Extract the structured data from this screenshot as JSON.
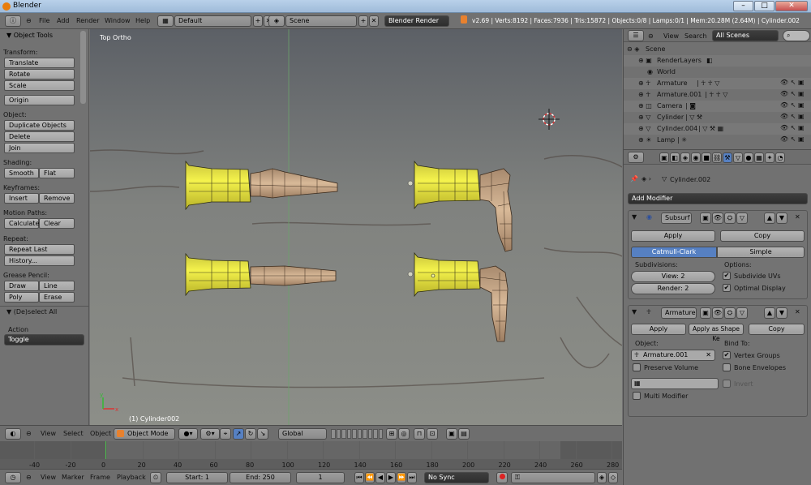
{
  "window": {
    "title": "Blender"
  },
  "info": {
    "menus": [
      "File",
      "Add",
      "Render",
      "Window",
      "Help"
    ],
    "screen_layout": "Default",
    "scene": "Scene",
    "engine": "Blender Render",
    "stats": "v2.69 | Verts:8192 | Faces:7936 | Tris:15872 | Objects:0/8 | Lamps:0/1 | Mem:20.28M (2.64M) | Cylinder.002"
  },
  "tools": {
    "header": "Object Tools",
    "transform_label": "Transform:",
    "translate": "Translate",
    "rotate": "Rotate",
    "scale": "Scale",
    "origin": "Origin",
    "object_label": "Object:",
    "duplicate": "Duplicate Objects",
    "delete": "Delete",
    "join": "Join",
    "shading_label": "Shading:",
    "smooth": "Smooth",
    "flat": "Flat",
    "keyframes_label": "Keyframes:",
    "insert": "Insert",
    "remove": "Remove",
    "motion_label": "Motion Paths:",
    "calculate": "Calculate",
    "clear": "Clear",
    "repeat_label": "Repeat:",
    "repeat_last": "Repeat Last",
    "history": "History...",
    "grease_label": "Grease Pencil:",
    "draw": "Draw",
    "line": "Line",
    "poly": "Poly",
    "erase": "Erase",
    "deselect_header": "(De)select All",
    "action_label": "Action",
    "action_value": "Toggle"
  },
  "viewport": {
    "view_name": "Top Ortho",
    "object_label": "(1) Cylinder002"
  },
  "view3d_header": {
    "view": "View",
    "select": "Select",
    "object": "Object",
    "mode": "Object Mode",
    "orientation": "Global"
  },
  "timeline": {
    "ticks": [
      "-40",
      "-20",
      "0",
      "20",
      "40",
      "60",
      "80",
      "100",
      "120",
      "140",
      "160",
      "180",
      "200",
      "220",
      "240",
      "260",
      "280"
    ],
    "menus": [
      "View",
      "Marker",
      "Frame",
      "Playback"
    ],
    "start": "Start: 1",
    "end": "End: 250",
    "current": "1",
    "sync": "No Sync"
  },
  "outliner": {
    "view": "View",
    "search": "Search",
    "display": "All Scenes",
    "items": [
      {
        "name": "Scene"
      },
      {
        "name": "RenderLayers"
      },
      {
        "name": "World"
      },
      {
        "name": "Armature"
      },
      {
        "name": "Armature.001"
      },
      {
        "name": "Camera"
      },
      {
        "name": "Cylinder"
      },
      {
        "name": "Cylinder.004"
      },
      {
        "name": "Lamp"
      }
    ]
  },
  "properties": {
    "breadcrumb": "Cylinder.002",
    "add_modifier": "Add Modifier",
    "subsurf": {
      "name": "Subsurf",
      "apply": "Apply",
      "copy": "Copy",
      "catmull": "Catmull-Clark",
      "simple": "Simple",
      "subdivisions_label": "Subdivisions:",
      "view": "View: 2",
      "render": "Render: 2",
      "options_label": "Options:",
      "subdivide_uvs": "Subdivide UVs",
      "optimal_display": "Optimal Display"
    },
    "armature": {
      "name": "Armature",
      "apply": "Apply",
      "apply_shape": "Apply as Shape Ke",
      "copy": "Copy",
      "object_label": "Object:",
      "object_value": "Armature.001",
      "bind_label": "Bind To:",
      "vertex_groups": "Vertex Groups",
      "bone_envelopes": "Bone Envelopes",
      "preserve_volume": "Preserve Volume",
      "invert": "Invert",
      "multi_modifier": "Multi Modifier"
    }
  },
  "colors": {
    "accent": "#5680c2",
    "object_yellow": "#e6e63c",
    "bone_tan": "#c7a584",
    "orange": "#e8812e"
  }
}
